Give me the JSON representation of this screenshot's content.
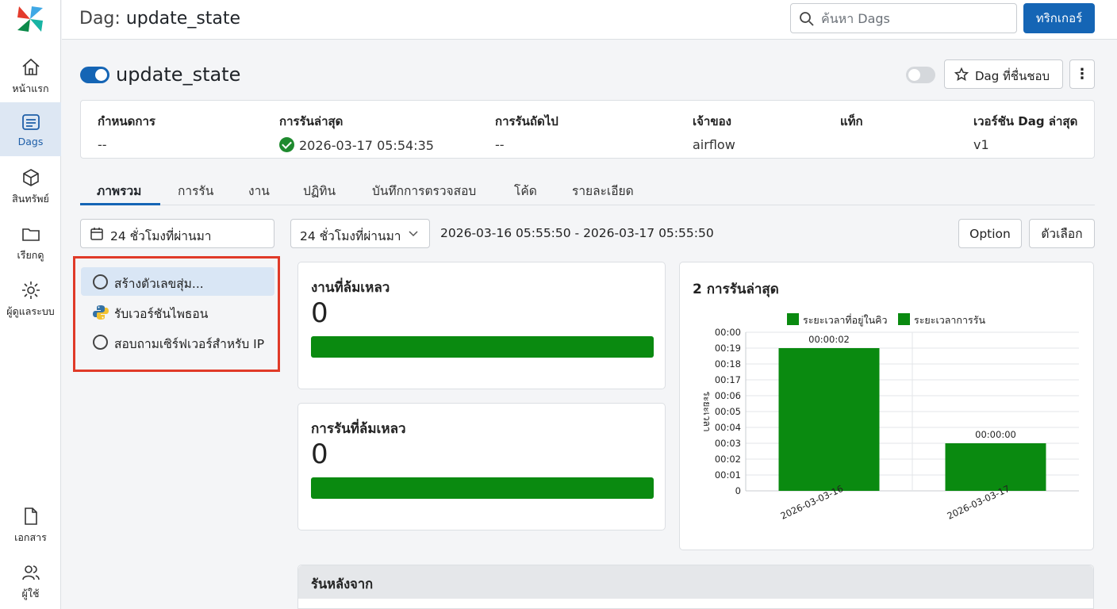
{
  "sidebar": {
    "items": [
      {
        "label": "หน้าแรก",
        "icon": "home-icon"
      },
      {
        "label": "Dags",
        "icon": "dags-icon"
      },
      {
        "label": "สินทรัพย์",
        "icon": "box-icon"
      },
      {
        "label": "เรียกดู",
        "icon": "folder-icon"
      },
      {
        "label": "ผู้ดูแลระบบ",
        "icon": "gear-icon"
      },
      {
        "label": "เอกสาร",
        "icon": "document-icon"
      },
      {
        "label": "ผู้ใช้",
        "icon": "users-icon"
      }
    ]
  },
  "header": {
    "prefix": "Dag:",
    "dag_id": "update_state",
    "search_placeholder": "ค้นหา Dags",
    "trigger_label": "ทริกเกอร์"
  },
  "dag": {
    "name": "update_state",
    "favorite_label": "Dag ที่ชื่นชอบ",
    "more_label": "⋮"
  },
  "info": [
    {
      "key": "กำหนดการ",
      "value": "--"
    },
    {
      "key": "การรันล่าสุด",
      "value": "2026-03-17 05:54:35"
    },
    {
      "key": "การรันถัดไป",
      "value": "--"
    },
    {
      "key": "เจ้าของ",
      "value": "airflow"
    },
    {
      "key": "แท็ก",
      "value": ""
    },
    {
      "key": "เวอร์ชัน Dag ล่าสุด",
      "value": "v1"
    }
  ],
  "tabs": [
    "ภาพรวม",
    "การรัน",
    "งาน",
    "ปฏิทิน",
    "บันทึกการตรวจสอบ",
    "โค้ด",
    "รายละเอียด"
  ],
  "filters": {
    "date_button": "24 ชั่วโมงที่ผ่านมา",
    "range_select": "24 ชั่วโมงที่ผ่านมา",
    "range_text": "2026-03-16 05:55:50 - 2026-03-17 05:55:50",
    "option_label": "Option",
    "options_label": "ตัวเลือก"
  },
  "tasks": [
    {
      "label": "สร้างตัวเลขสุ่ม...",
      "icon": "circle-icon",
      "selected": true
    },
    {
      "label": "รับเวอร์ชันไพธอน",
      "icon": "python-icon",
      "selected": false
    },
    {
      "label": "สอบถามเซิร์ฟเวอร์สำหรับ IP",
      "icon": "circle-icon",
      "selected": false
    }
  ],
  "stats": {
    "failed_tasks": {
      "title": "งานที่ล้มเหลว",
      "value": "0"
    },
    "failed_runs": {
      "title": "การรันที่ล้มเหลว",
      "value": "0"
    }
  },
  "chart_data": {
    "type": "bar",
    "title": "2 การรันล่าสุด",
    "ylabel": "ระยะเวลา",
    "legend": [
      "ระยะเวลาที่อยู่ในคิว",
      "ระยะเวลาการรัน"
    ],
    "legend_position": "top",
    "categories": [
      "2026-03-03-16",
      "2026-03-03-17"
    ],
    "y_ticks": [
      "00:00",
      "00:19",
      "00:18",
      "00:17",
      "00:06",
      "00:05",
      "00:04",
      "00:03",
      "00:02",
      "00:01",
      "0"
    ],
    "series": [
      {
        "name": "ระยะเวลาการรัน",
        "values": [
          0.9,
          0.3
        ]
      }
    ],
    "data_labels": [
      "00:00:02",
      "00:00:00"
    ],
    "color": "#0a8a10",
    "grid": true
  },
  "bottom": {
    "title": "รันหลังจาก"
  }
}
